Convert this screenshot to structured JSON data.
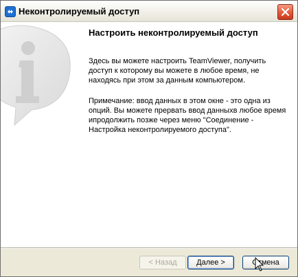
{
  "window": {
    "title": "Неконтролируемый доступ"
  },
  "content": {
    "heading": "Настроить неконтролируемый доступ",
    "description": "Здесь вы можете настроить TeamViewer, получить доступ к которому вы можете в любое время, не находясь при этом за данным компьютером.",
    "note": "Примечание: ввод данных в этом окне  - это одна из опций. Вы можете прервать ввод данныхв любое время ипродолжить позже через меню \"Соединение - Настройка неконтролируемого доступа\"."
  },
  "buttons": {
    "back": "< Назад",
    "next": "Далее >",
    "cancel": "Отмена"
  },
  "icons": {
    "app": "teamviewer-icon",
    "close": "close-icon",
    "info": "info-icon",
    "cursor": "mouse-cursor-icon"
  },
  "colors": {
    "close_button": "#e35a3a",
    "title_bar": "#f2f1ea",
    "button_border": "#003c74"
  }
}
